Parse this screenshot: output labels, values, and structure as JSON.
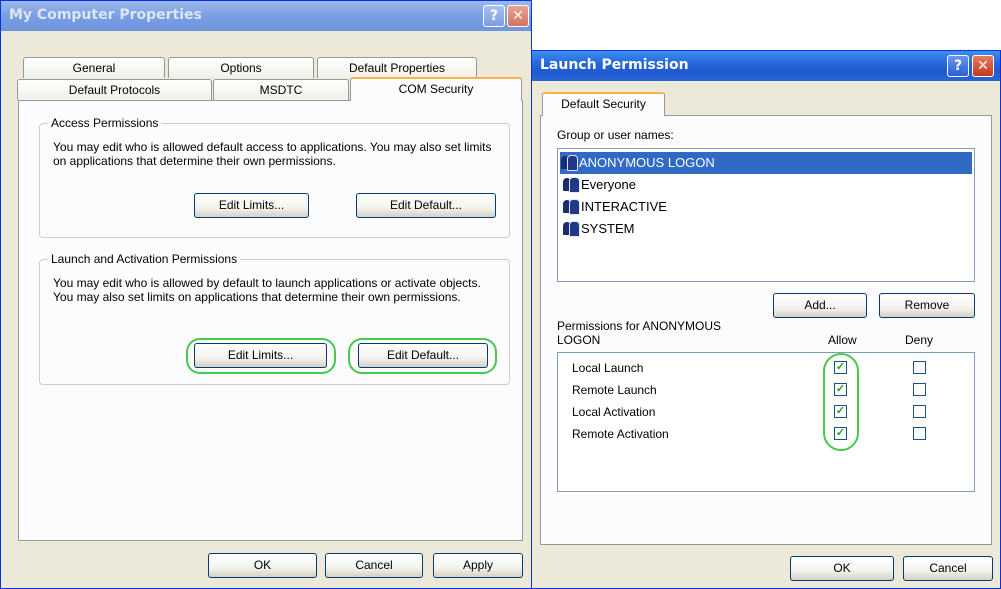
{
  "left_window": {
    "title": "My Computer Properties",
    "help_glyph": "?",
    "close_glyph": "✕",
    "tabs_row1": [
      "General",
      "Options",
      "Default Properties"
    ],
    "tabs_row2": [
      "Default Protocols",
      "MSDTC",
      "COM Security"
    ],
    "access_group": {
      "legend": "Access Permissions",
      "text": "You may edit who is allowed default access to applications. You may also set limits on applications that determine their own permissions.",
      "edit_limits": "Edit Limits...",
      "edit_default": "Edit Default..."
    },
    "launch_group": {
      "legend": "Launch and Activation Permissions",
      "text": "You may edit who is allowed by default to launch applications or activate objects. You may also set limits on applications that determine their own permissions.",
      "edit_limits": "Edit Limits...",
      "edit_default": "Edit Default..."
    },
    "buttons": {
      "ok": "OK",
      "cancel": "Cancel",
      "apply": "Apply"
    }
  },
  "right_window": {
    "title": "Launch Permission",
    "help_glyph": "?",
    "close_glyph": "✕",
    "tab": "Default Security",
    "group_label": "Group or user names:",
    "users": [
      "ANONYMOUS LOGON",
      "Everyone",
      "INTERACTIVE",
      "SYSTEM"
    ],
    "selected_user_index": 0,
    "add_button": "Add...",
    "remove_button": "Remove",
    "permissions_for": "Permissions for ANONYMOUS LOGON",
    "allow_header": "Allow",
    "deny_header": "Deny",
    "permissions": [
      {
        "name": "Local Launch",
        "allow": true,
        "deny": false
      },
      {
        "name": "Remote Launch",
        "allow": true,
        "deny": false
      },
      {
        "name": "Local Activation",
        "allow": true,
        "deny": false
      },
      {
        "name": "Remote Activation",
        "allow": true,
        "deny": false
      }
    ],
    "check_glyph": "✓",
    "buttons": {
      "ok": "OK",
      "cancel": "Cancel"
    }
  },
  "colors": {
    "title_active": "#2464d8",
    "title_inactive": "#7a9ee3",
    "highlight_ring": "#47c94a",
    "selection": "#316ac5"
  }
}
